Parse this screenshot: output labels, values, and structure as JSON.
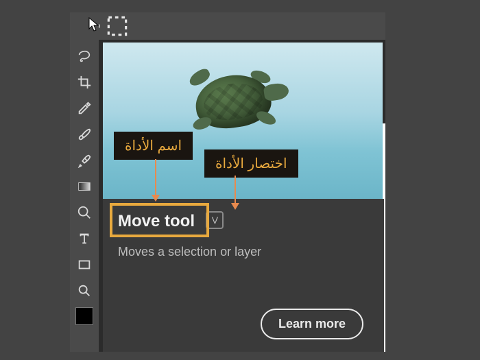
{
  "toolbar": {
    "tools": [
      {
        "name": "move",
        "icon": "move-icon"
      },
      {
        "name": "marquee",
        "icon": "marquee-icon"
      },
      {
        "name": "lasso",
        "icon": "lasso-icon"
      },
      {
        "name": "crop",
        "icon": "crop-icon"
      },
      {
        "name": "eyedropper",
        "icon": "eyedropper-icon"
      },
      {
        "name": "brush",
        "icon": "brush-icon"
      },
      {
        "name": "healing",
        "icon": "healing-icon"
      },
      {
        "name": "gradient",
        "icon": "gradient-icon"
      },
      {
        "name": "zoom",
        "icon": "zoom-icon"
      },
      {
        "name": "type",
        "icon": "type-icon"
      },
      {
        "name": "rectangle",
        "icon": "rectangle-icon"
      },
      {
        "name": "search",
        "icon": "search-icon"
      }
    ]
  },
  "tooltip": {
    "tool_name": "Move tool",
    "shortcut": "V",
    "description": "Moves a selection or layer",
    "learn_more": "Learn more"
  },
  "annotations": {
    "tool_name_label": "اسم الأداة",
    "tool_shortcut_label": "اختصار الأداة"
  },
  "colors": {
    "annotation_bg": "#1a1510",
    "annotation_text": "#e8a93e",
    "highlight_border": "#e8a93e",
    "arrow": "#e88a4e"
  }
}
